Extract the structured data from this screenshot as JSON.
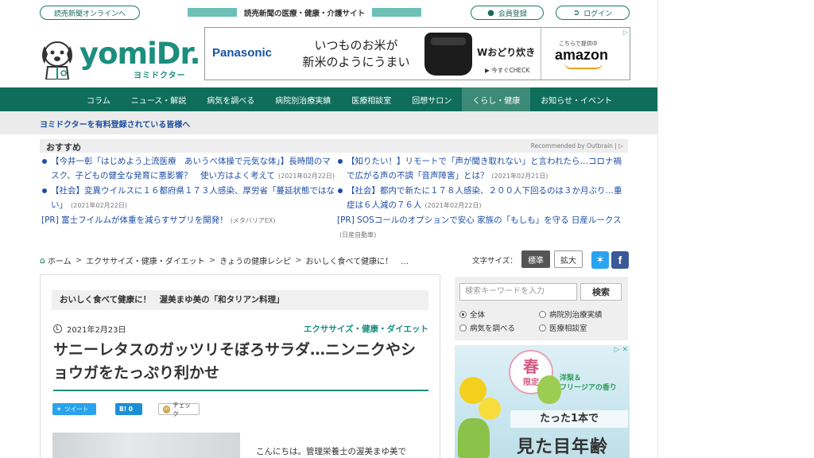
{
  "topbar": {
    "yomiuri_online": "読売新聞オンラインへ",
    "site_tagline": "読売新聞の医療・健康・介護サイト",
    "register": "会員登録",
    "login": "ログイン"
  },
  "logo": {
    "word": "yomiDr.",
    "sub": "ヨミドクター"
  },
  "ad_banner": {
    "brand": "Panasonic",
    "copy_line1": "いつものお米が",
    "copy_line2": "新米のようにうまい",
    "product": "Wおどり炊き",
    "cta": "▶ 今すぐCHECK",
    "supplied_by": "こちらで提供中",
    "retailer": "amazon"
  },
  "nav": {
    "items": [
      {
        "label": "コラム"
      },
      {
        "label": "ニュース・解説"
      },
      {
        "label": "病気を調べる"
      },
      {
        "label": "病院別治療実績"
      },
      {
        "label": "医療相談室"
      },
      {
        "label": "回想サロン"
      },
      {
        "label": "くらし・健康"
      },
      {
        "label": "お知らせ・イベント"
      }
    ],
    "active_index": 6
  },
  "member_notice": "ヨミドクターを有料登録されている皆様へ",
  "recommend": {
    "heading": "おすすめ",
    "by": "Recommended by Outbrain",
    "left": [
      {
        "text": "【今井一彰「はじめよう上流医療　あいうべ体操で元気な体」】長時間のマスク、子どもの健全な発育に悪影響？　使い方はよく考えて",
        "date": "(2021年02月22日)"
      },
      {
        "text": "【社会】変異ウイルスに１６都府県１７３人感染、厚労省「蔓延状態ではない」",
        "date": "(2021年02月22日)"
      }
    ],
    "left_pr": {
      "text": "[PR] 富士フイルムが体重を減らすサプリを開発！",
      "source": "(メタバリアEX)"
    },
    "right": [
      {
        "text": "【知りたい！】リモートで「声が聞き取れない」と言われたら…コロナ禍で広がる声の不調「音声障害」とは？",
        "date": "(2021年02月21日)"
      },
      {
        "text": "【社会】都内で新たに１７８人感染、２００人下回るのは３か月ぶり…重症は６人減の７６人",
        "date": "(2021年02月22日)"
      }
    ],
    "right_pr": {
      "text": "[PR] SOSコールのオプションで安心 家族の「もしも」を守る 日産ルークス",
      "source": "(日産自動車)"
    }
  },
  "breadcrumb": {
    "items": [
      "ホーム",
      "エクササイズ・健康・ダイエット",
      "きょうの健康レシピ",
      "おいしく食べて健康に！　…"
    ]
  },
  "font_size": {
    "label": "文字サイズ：",
    "standard": "標準",
    "large": "拡大"
  },
  "article": {
    "series": "おいしく食べて健康に！　渥美まゆ美の「和タリアン料理」",
    "date": "2021年2月23日",
    "category": "エクササイズ・健康・ダイエット",
    "title": "サニーレタスのガッツリそぼろサラダ…ニンニクやショウガをたっぷり利かせ",
    "share_tweet": "ツイート",
    "share_hatena": "B! 0",
    "share_mixi": "チェック",
    "body_start": "こんにちは。管理栄養士の渥美まゆ美で"
  },
  "sidebar": {
    "search_placeholder": "検索キーワードを入力",
    "search_button": "検索",
    "radios": [
      {
        "label": "全体",
        "selected": true
      },
      {
        "label": "病院別治療実績",
        "selected": false
      },
      {
        "label": "病気を調べる",
        "selected": false
      },
      {
        "label": "医療相談室",
        "selected": false
      }
    ],
    "ad": {
      "badge_big": "春",
      "badge_small": "限定",
      "note1": "洋梨＆",
      "note2": "フリージアの香り",
      "line1": "たった1本で",
      "line2": "見た目年齢"
    }
  },
  "colors": {
    "brand_green": "#0e6e5a",
    "logo_teal": "#1c8e7e",
    "link_blue": "#1e4ea6"
  }
}
